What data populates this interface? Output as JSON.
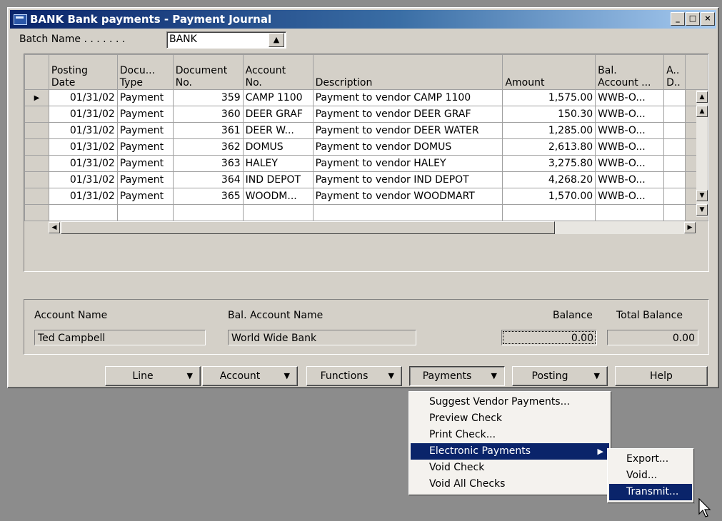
{
  "window": {
    "title": "BANK Bank payments - Payment Journal",
    "controls": {
      "minimize": "_",
      "maximize": "□",
      "close": "×"
    }
  },
  "batch": {
    "label": "Batch Name . . . . . . .",
    "value": "BANK"
  },
  "table": {
    "headers": [
      [
        "Posting",
        "Date"
      ],
      [
        "Docu...",
        "Type"
      ],
      [
        "Document",
        "No."
      ],
      [
        "Account",
        "No."
      ],
      [
        "",
        "Description"
      ],
      [
        "",
        "Amount"
      ],
      [
        "Bal.",
        "Account ..."
      ],
      [
        "A..",
        "D.."
      ]
    ],
    "rows": [
      {
        "date": "01/31/02",
        "type": "Payment",
        "doc": "359",
        "acct": "CAMP 1100",
        "desc": "Payment to vendor CAMP 1100",
        "amount": "1,575.00",
        "bal": "WWB-O..."
      },
      {
        "date": "01/31/02",
        "type": "Payment",
        "doc": "360",
        "acct": "DEER GRAF",
        "desc": "Payment to vendor DEER GRAF",
        "amount": "150.30",
        "bal": "WWB-O..."
      },
      {
        "date": "01/31/02",
        "type": "Payment",
        "doc": "361",
        "acct": "DEER W...",
        "desc": "Payment to vendor DEER WATER",
        "amount": "1,285.00",
        "bal": "WWB-O..."
      },
      {
        "date": "01/31/02",
        "type": "Payment",
        "doc": "362",
        "acct": "DOMUS",
        "desc": "Payment to vendor DOMUS",
        "amount": "2,613.80",
        "bal": "WWB-O..."
      },
      {
        "date": "01/31/02",
        "type": "Payment",
        "doc": "363",
        "acct": "HALEY",
        "desc": "Payment to vendor HALEY",
        "amount": "3,275.80",
        "bal": "WWB-O..."
      },
      {
        "date": "01/31/02",
        "type": "Payment",
        "doc": "364",
        "acct": "IND DEPOT",
        "desc": "Payment to vendor IND DEPOT",
        "amount": "4,268.20",
        "bal": "WWB-O..."
      },
      {
        "date": "01/31/02",
        "type": "Payment",
        "doc": "365",
        "acct": "WOODM...",
        "desc": "Payment to vendor WOODMART",
        "amount": "1,570.00",
        "bal": "WWB-O..."
      }
    ]
  },
  "info": {
    "account_name_label": "Account Name",
    "account_name": "Ted Campbell",
    "bal_account_name_label": "Bal. Account Name",
    "bal_account_name": "World Wide Bank",
    "balance_label": "Balance",
    "balance": "0.00",
    "total_balance_label": "Total Balance",
    "total_balance": "0.00"
  },
  "buttons": {
    "line": "Line",
    "account": "Account",
    "functions": "Functions",
    "payments": "Payments",
    "posting": "Posting",
    "help": "Help"
  },
  "payments_menu": [
    "Suggest Vendor Payments...",
    "Preview Check",
    "Print Check...",
    "Electronic Payments",
    "Void Check",
    "Void All Checks"
  ],
  "electronic_submenu": [
    "Export...",
    "Void...",
    "Transmit..."
  ],
  "colors": {
    "title_bar": "#0a246a",
    "highlight": "#0a246a",
    "face": "#d4d0c8",
    "desktop": "#8c8c8c"
  }
}
